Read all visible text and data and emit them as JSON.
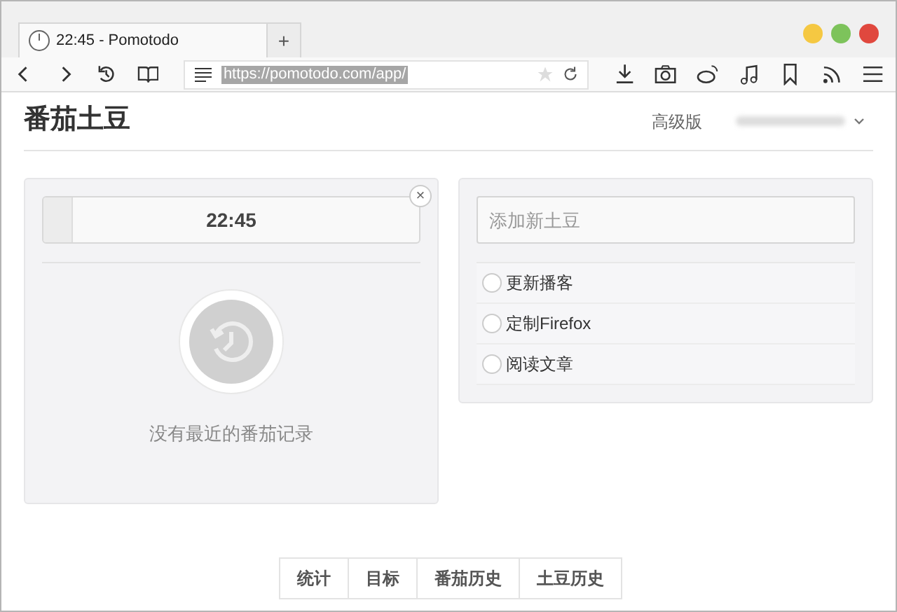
{
  "browser": {
    "tab_title": "22:45 - Pomotodo",
    "new_tab": "+",
    "url": "https://pomotodo.com/app/"
  },
  "app": {
    "title": "番茄土豆",
    "premium": "高级版"
  },
  "timer": {
    "time": "22:45",
    "level": 0.08,
    "close": "×",
    "empty_message": "没有最近的番茄记录"
  },
  "todo": {
    "placeholder": "添加新土豆",
    "items": [
      {
        "label": "更新播客",
        "checked": false
      },
      {
        "label": "定制Firefox",
        "checked": false
      },
      {
        "label": "阅读文章",
        "checked": false
      }
    ]
  },
  "bottom_tabs": [
    {
      "label": "统计",
      "selected": false
    },
    {
      "label": "目标",
      "selected": false
    },
    {
      "label": "番茄历史",
      "selected": false
    },
    {
      "label": "土豆历史",
      "selected": false
    }
  ]
}
